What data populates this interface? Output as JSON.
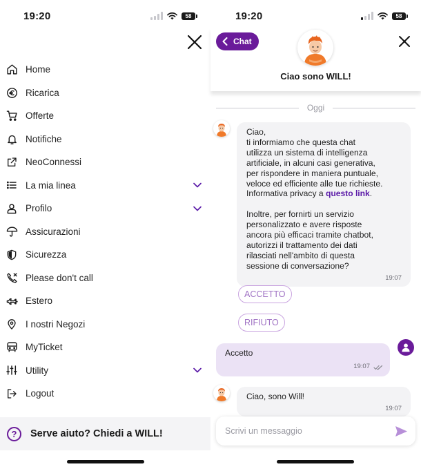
{
  "status_bar": {
    "time": "19:20",
    "battery": "58"
  },
  "menu": {
    "items": [
      {
        "label": "Home",
        "icon": "home-icon",
        "expandable": false
      },
      {
        "label": "Ricarica",
        "icon": "euro-icon",
        "expandable": false
      },
      {
        "label": "Offerte",
        "icon": "cart-icon",
        "expandable": false
      },
      {
        "label": "Notifiche",
        "icon": "bell-icon",
        "expandable": false
      },
      {
        "label": "NeoConnessi",
        "icon": "external-link-icon",
        "expandable": false
      },
      {
        "label": "La mia linea",
        "icon": "list-icon",
        "expandable": true
      },
      {
        "label": "Profilo",
        "icon": "user-icon",
        "expandable": true
      },
      {
        "label": "Assicurazioni",
        "icon": "umbrella-icon",
        "expandable": false
      },
      {
        "label": "Sicurezza",
        "icon": "shield-icon",
        "expandable": false
      },
      {
        "label": "Please don't call",
        "icon": "phone-off-icon",
        "expandable": false
      },
      {
        "label": "Estero",
        "icon": "plane-icon",
        "expandable": false
      },
      {
        "label": "I nostri Negozi",
        "icon": "location-pin-icon",
        "expandable": false
      },
      {
        "label": "MyTicket",
        "icon": "bus-icon",
        "expandable": false
      },
      {
        "label": "Utility",
        "icon": "sliders-icon",
        "expandable": true
      },
      {
        "label": "Logout",
        "icon": "logout-icon",
        "expandable": false
      }
    ],
    "help_label": "Serve aiuto? Chiedi a WILL!"
  },
  "chat": {
    "back_label": "Chat",
    "title": "Ciao sono WILL!",
    "divider_label": "Oggi",
    "first_message": {
      "lines_a": [
        "Ciao,",
        "ti informiamo che questa chat",
        "utilizza un sistema di intelligenza",
        "artificiale, in alcuni casi generativa,",
        "per rispondere in maniera puntuale,",
        "veloce ed efficiente alle tue richieste."
      ],
      "privacy_prefix": "Informativa privacy a ",
      "privacy_link": "questo link",
      "privacy_suffix": ".",
      "lines_b": [
        "Inoltre, per fornirti un servizio",
        "personalizzato e avere risposte",
        "ancora più efficaci tramite chatbot,",
        "autorizzi il trattamento dei dati",
        "rilasciati nell'ambito di questa",
        "sessione di conversazione?"
      ],
      "time": "19:07"
    },
    "quick_replies": [
      "ACCETTO",
      "RIFIUTO"
    ],
    "user_message": {
      "text": "Accetto",
      "time": "19:07"
    },
    "second_message": {
      "text": "Ciao, sono Will!",
      "time": "19:07"
    },
    "composer_placeholder": "Scrivi un messaggio"
  },
  "colors": {
    "brand_purple": "#6a1b9a",
    "quick_reply_border": "#c9a4e0",
    "user_bubble": "#ebe2f5",
    "bot_bubble": "#f3f3f5"
  }
}
